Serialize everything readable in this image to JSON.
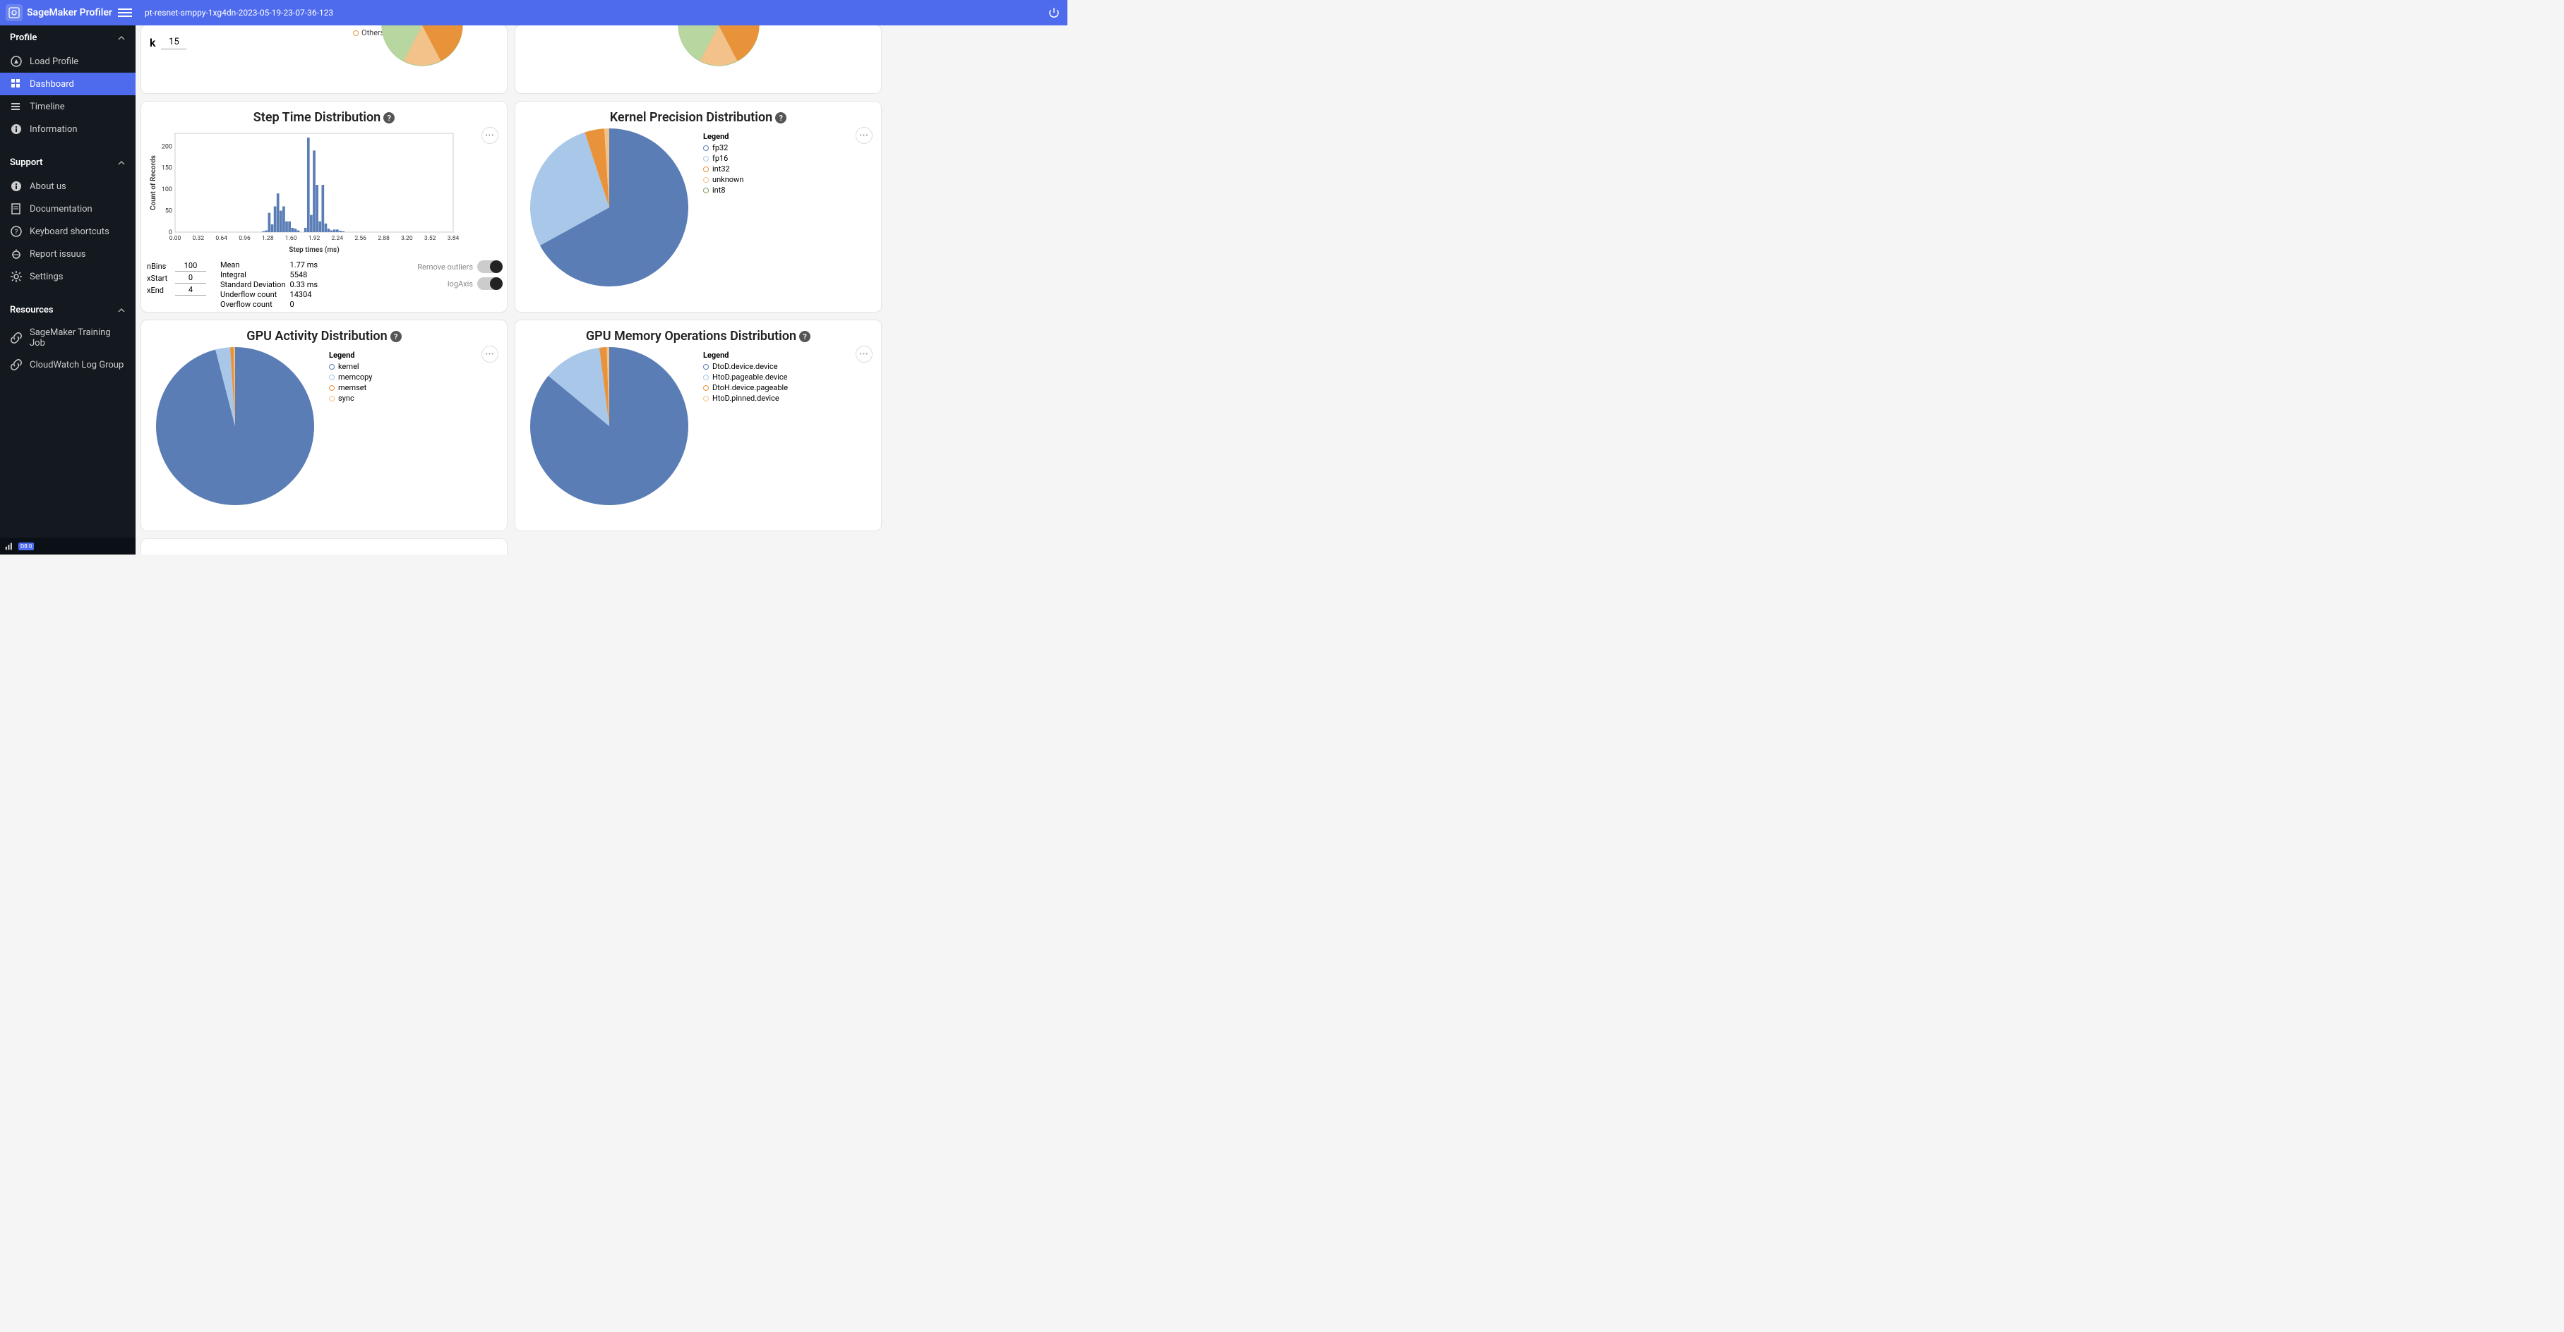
{
  "header": {
    "app_name": "SageMaker Profiler",
    "job_title": "pt-resnet-smppy-1xg4dn-2023-05-19-23-07-36-123"
  },
  "sidebar": {
    "sections": [
      {
        "title": "Profile",
        "items": [
          {
            "label": "Load Profile",
            "icon": "compass"
          },
          {
            "label": "Dashboard",
            "icon": "dashboard",
            "active": true
          },
          {
            "label": "Timeline",
            "icon": "timeline"
          },
          {
            "label": "Information",
            "icon": "info"
          }
        ]
      },
      {
        "title": "Support",
        "items": [
          {
            "label": "About us",
            "icon": "info"
          },
          {
            "label": "Documentation",
            "icon": "doc"
          },
          {
            "label": "Keyboard shortcuts",
            "icon": "help"
          },
          {
            "label": "Report issuus",
            "icon": "bug"
          },
          {
            "label": "Settings",
            "icon": "settings"
          }
        ]
      },
      {
        "title": "Resources",
        "items": [
          {
            "label": "SageMaker Training Job",
            "icon": "link"
          },
          {
            "label": "CloudWatch Log Group",
            "icon": "link"
          }
        ]
      }
    ],
    "badge": "D8 0"
  },
  "top_partial": {
    "k_label": "k",
    "k_value": "15",
    "others_label": "Others"
  },
  "step_time": {
    "title": "Step Time Distribution",
    "xlabel": "Step times (ms)",
    "ylabel": "Count of Records",
    "nBins_label": "nBins",
    "nBins": "100",
    "xStart_label": "xStart",
    "xStart": "0",
    "xEnd_label": "xEnd",
    "xEnd": "4",
    "stats": {
      "Mean": "1.77 ms",
      "Integral": "5548",
      "Standard Deviation": "0.33 ms",
      "Underflow count": "14304",
      "Overflow count": "0"
    },
    "toggles": {
      "remove_outliers": "Remove outliers",
      "log_axis": "logAxis"
    }
  },
  "kernel_precision": {
    "title": "Kernel Precision Distribution",
    "legend_title": "Legend",
    "items": [
      {
        "label": "fp32",
        "color": "#5a7db5"
      },
      {
        "label": "fp16",
        "color": "#a9c7e8"
      },
      {
        "label": "int32",
        "color": "#e8933a"
      },
      {
        "label": "unknown",
        "color": "#f3c28b"
      },
      {
        "label": "int8",
        "color": "#7aa05b"
      }
    ]
  },
  "gpu_activity": {
    "title": "GPU Activity Distribution",
    "legend_title": "Legend",
    "items": [
      {
        "label": "kernel",
        "color": "#5a7db5"
      },
      {
        "label": "memcopy",
        "color": "#a9c7e8"
      },
      {
        "label": "memset",
        "color": "#e8933a"
      },
      {
        "label": "sync",
        "color": "#f3c28b"
      }
    ]
  },
  "gpu_memops": {
    "title": "GPU Memory Operations Distribution",
    "legend_title": "Legend",
    "items": [
      {
        "label": "DtoD.device.device",
        "color": "#5a7db5"
      },
      {
        "label": "HtoD.pageable.device",
        "color": "#a9c7e8"
      },
      {
        "label": "DtoH.device.pageable",
        "color": "#e8933a"
      },
      {
        "label": "HtoD.pinned.device",
        "color": "#f3c28b"
      }
    ]
  },
  "chart_data": [
    {
      "type": "bar",
      "id": "step_time_hist",
      "title": "Step Time Distribution",
      "xlabel": "Step times (ms)",
      "ylabel": "Count of Records",
      "xticks": [
        0.0,
        0.32,
        0.64,
        0.96,
        1.28,
        1.6,
        1.92,
        2.24,
        2.56,
        2.88,
        3.2,
        3.52,
        3.84
      ],
      "ylim": [
        0,
        230
      ],
      "yticks": [
        0,
        50,
        100,
        150,
        200
      ],
      "bin_width": 0.04,
      "categories": [
        1.22,
        1.26,
        1.3,
        1.34,
        1.38,
        1.42,
        1.46,
        1.5,
        1.54,
        1.58,
        1.62,
        1.66,
        1.7,
        1.8,
        1.84,
        1.88,
        1.92,
        1.96,
        2.0,
        2.04,
        2.08,
        2.12,
        2.16,
        2.2,
        2.24,
        2.28,
        2.32
      ],
      "values": [
        2,
        4,
        45,
        18,
        60,
        90,
        50,
        60,
        25,
        25,
        10,
        8,
        4,
        10,
        220,
        40,
        190,
        110,
        25,
        110,
        20,
        8,
        4,
        6,
        6,
        3,
        2
      ]
    },
    {
      "type": "pie",
      "id": "kernel_precision_pie",
      "title": "Kernel Precision Distribution",
      "series": [
        {
          "name": "fp32",
          "value": 67,
          "color": "#5a7db5"
        },
        {
          "name": "fp16",
          "value": 28,
          "color": "#a9c7e8"
        },
        {
          "name": "int32",
          "value": 4,
          "color": "#e8933a"
        },
        {
          "name": "unknown",
          "value": 1,
          "color": "#f3c28b"
        },
        {
          "name": "int8",
          "value": 0,
          "color": "#7aa05b"
        }
      ]
    },
    {
      "type": "pie",
      "id": "gpu_activity_pie",
      "title": "GPU Activity Distribution",
      "series": [
        {
          "name": "kernel",
          "value": 96,
          "color": "#5a7db5"
        },
        {
          "name": "memcopy",
          "value": 3,
          "color": "#a9c7e8"
        },
        {
          "name": "memset",
          "value": 0.7,
          "color": "#e8933a"
        },
        {
          "name": "sync",
          "value": 0.3,
          "color": "#f3c28b"
        }
      ]
    },
    {
      "type": "pie",
      "id": "gpu_memops_pie",
      "title": "GPU Memory Operations Distribution",
      "series": [
        {
          "name": "DtoD.device.device",
          "value": 86,
          "color": "#5a7db5"
        },
        {
          "name": "HtoD.pageable.device",
          "value": 12,
          "color": "#a9c7e8"
        },
        {
          "name": "DtoH.device.pageable",
          "value": 1.5,
          "color": "#e8933a"
        },
        {
          "name": "HtoD.pinned.device",
          "value": 0.5,
          "color": "#f3c28b"
        }
      ]
    }
  ]
}
